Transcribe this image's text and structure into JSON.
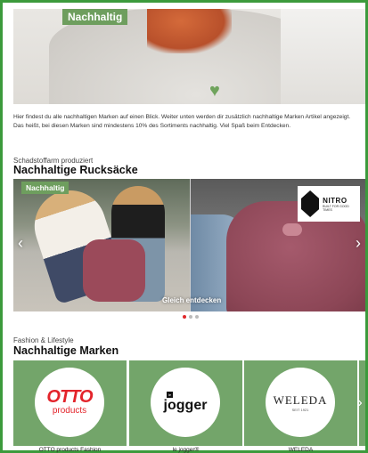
{
  "hero": {
    "badge": "Nachhaltig"
  },
  "intro": "Hier findest du alle nachhaltigen Marken auf einen Blick. Weiter unten werden dir zusätzlich nachhaltige Marken Artikel angezeigt. Das heißt, bei diesen Marken sind mindestens 10% des Sortiments nachhaltig. Viel Spaß beim Entdecken.",
  "backpacks": {
    "kicker": "Schadstoffarm produziert",
    "title": "Nachhaltige Rucksäcke",
    "slide_badge": "Nachhaltig",
    "brand_name": "NITRO",
    "brand_tagline": "BUILT FOR GOOD TIMES",
    "cta": "Gleich entdecken",
    "arrow_left": "‹",
    "arrow_right": "›",
    "dots_total": 3,
    "dots_active": 1
  },
  "brands": {
    "kicker": "Fashion & Lifestyle",
    "title": "Nachhaltige Marken",
    "tiles": [
      {
        "name": "OTTO products Fashion",
        "logo_main": "OTTO",
        "logo_sub": "products"
      },
      {
        "name": "le jogger®",
        "logo_box": "le",
        "logo_main": "jogger"
      },
      {
        "name": "WELEDA",
        "logo_main": "WELEDA",
        "logo_sub": "SEIT 1921"
      }
    ],
    "arrow_right": "›"
  },
  "colors": {
    "accent_green": "#6e9e5e",
    "tile_green": "#73a56a",
    "frame_green": "#3c9a3c",
    "dot_active": "#e0282a",
    "otto_red": "#e3242b"
  }
}
